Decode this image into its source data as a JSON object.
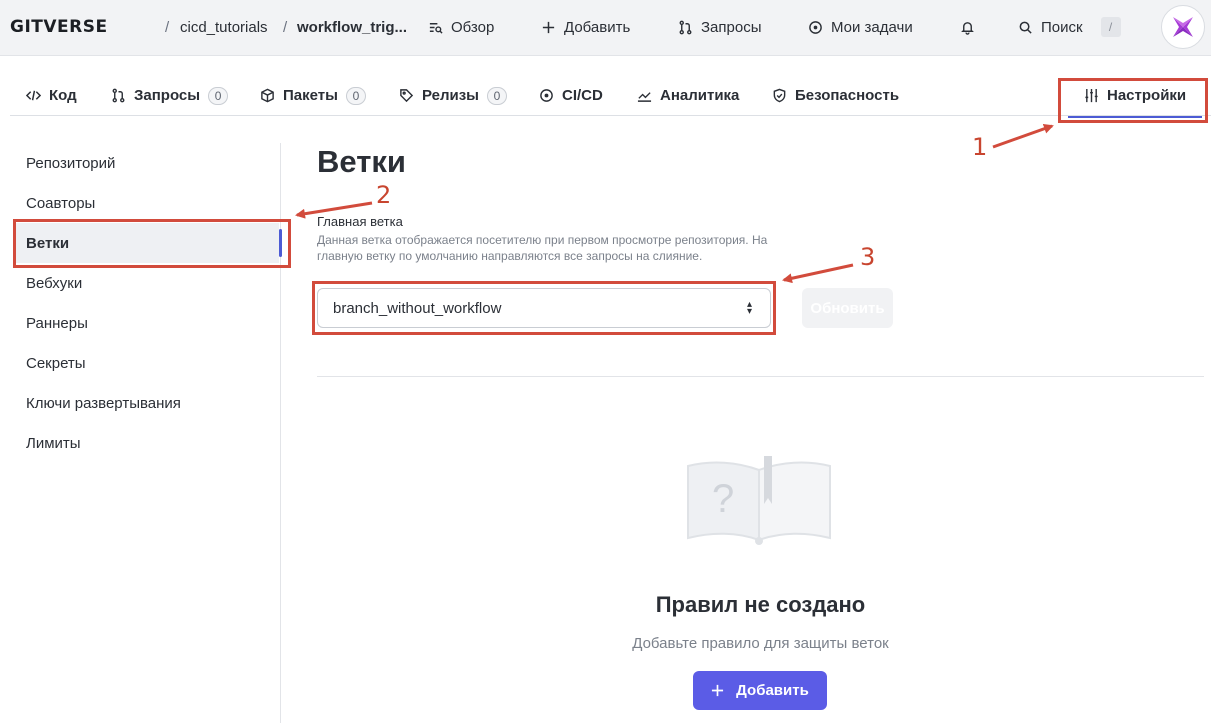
{
  "header": {
    "logo": "GITVERSE",
    "breadcrumb_sep": "/",
    "owner": "cicd_tutorials",
    "repo": "workflow_trig...",
    "nav": {
      "overview": "Обзор",
      "add": "Добавить",
      "requests": "Запросы",
      "my_tasks": "Мои задачи",
      "search": "Поиск",
      "search_shortcut": "/"
    }
  },
  "tabs": {
    "code": "Код",
    "requests": "Запросы",
    "requests_count": "0",
    "packages": "Пакеты",
    "packages_count": "0",
    "releases": "Релизы",
    "releases_count": "0",
    "cicd": "CI/CD",
    "analytics": "Аналитика",
    "security": "Безопасность",
    "settings": "Настройки"
  },
  "sidebar": {
    "items": [
      "Репозиторий",
      "Соавторы",
      "Ветки",
      "Вебхуки",
      "Раннеры",
      "Секреты",
      "Ключи развертывания",
      "Лимиты"
    ],
    "active": "Ветки"
  },
  "main": {
    "title": "Ветки",
    "default_branch_label": "Главная ветка",
    "default_branch_help": "Данная ветка отображается посетителю при первом просмотре репозитория. На главную ветку по умолчанию направляются все запросы на слияние.",
    "selected_branch": "branch_without_workflow",
    "update_button": "Обновить",
    "empty_title": "Правил не создано",
    "empty_text": "Добавьте правило для защиты веток",
    "add_button": "Добавить"
  },
  "annotations": {
    "one": "1",
    "two": "2",
    "three": "3",
    "color": "#d24b3c"
  },
  "colors": {
    "accent": "#4c5bd4",
    "primary_button": "#5b5ce6",
    "header_bg": "#f2f3f5"
  }
}
